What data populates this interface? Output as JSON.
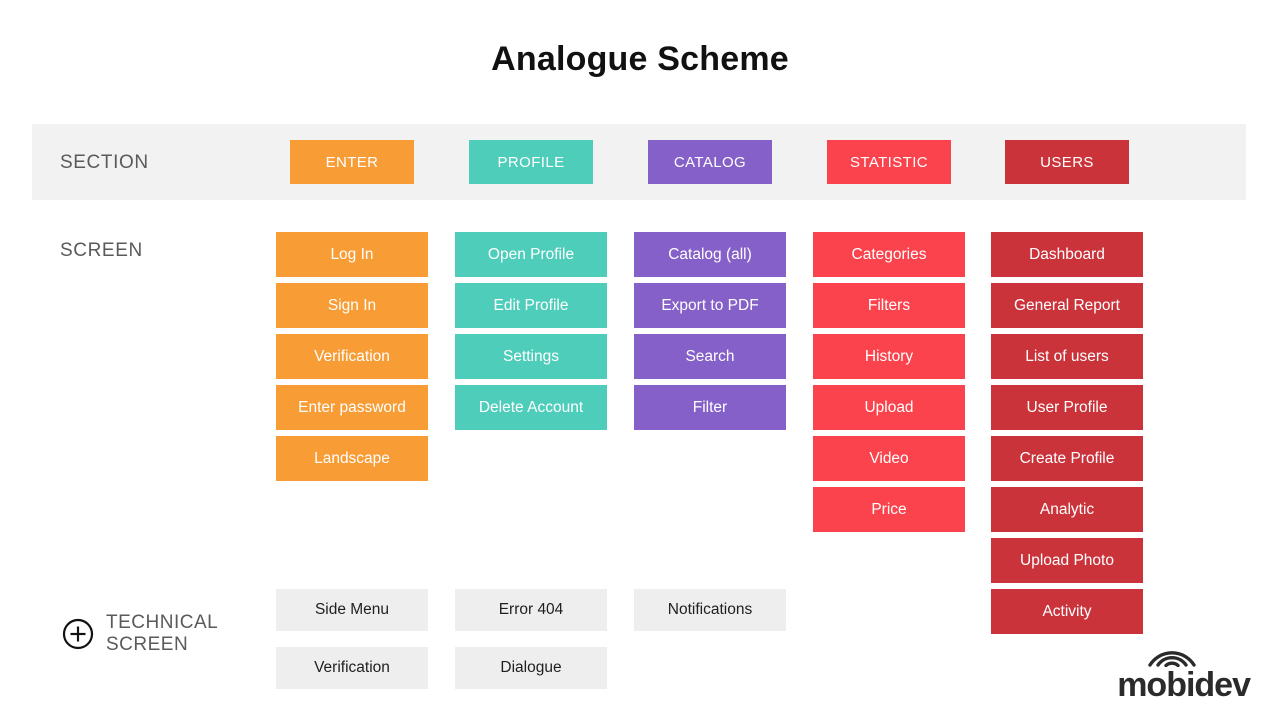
{
  "title": "Analogue Scheme",
  "rows": {
    "section_label": "SECTION",
    "screen_label": "SCREEN",
    "technical_label_line1": "TECHNICAL",
    "technical_label_line2": "SCREEN"
  },
  "colors": {
    "orange": "#F89C35",
    "teal": "#4ECDBB",
    "purple": "#8560C8",
    "red": "#FA434C",
    "dark_red": "#CB333B",
    "band_gray": "#F2F2F2",
    "chip_gray": "#EEEEEE",
    "label_gray": "#5A5A5A",
    "title_black": "#111111"
  },
  "columns": [
    {
      "section": "ENTER",
      "color": "#F89C35",
      "screens": [
        "Log In",
        "Sign In",
        "Verification",
        "Enter password",
        "Landscape"
      ],
      "technical": [
        "Side Menu",
        "Verification"
      ]
    },
    {
      "section": "PROFILE",
      "color": "#4ECDBB",
      "screens": [
        "Open Profile",
        "Edit Profile",
        "Settings",
        "Delete Account"
      ],
      "technical": [
        "Error 404",
        "Dialogue"
      ]
    },
    {
      "section": "CATALOG",
      "color": "#8560C8",
      "screens": [
        "Catalog (all)",
        "Export to PDF",
        "Search",
        "Filter"
      ],
      "technical": [
        "Notifications"
      ]
    },
    {
      "section": "STATISTIC",
      "color": "#FA434C",
      "screens": [
        "Categories",
        "Filters",
        "History",
        "Upload",
        "Video",
        "Price"
      ],
      "technical": []
    },
    {
      "section": "USERS",
      "color": "#CB333B",
      "screens": [
        "Dashboard",
        "General Report",
        "List of users",
        "User Profile",
        "Create Profile",
        "Analytic",
        "Upload Photo",
        "Activity"
      ],
      "technical": []
    }
  ],
  "logo": {
    "wordmark": "mobidev",
    "icon": "wifi-arc-icon"
  },
  "icons": {
    "technical_screen": "plus-circle-icon"
  }
}
